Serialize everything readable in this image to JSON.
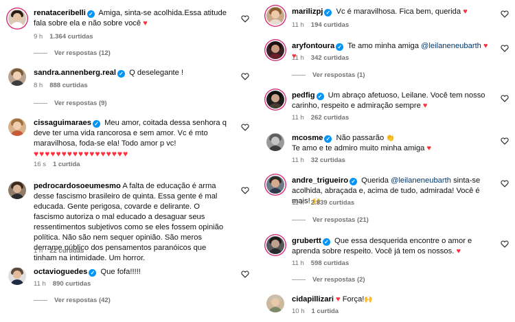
{
  "left": [
    {
      "username": "renataceribelli",
      "verified": true,
      "text": "Amiga, sinta-se acolhida.Essa atitude fala sobre ela e não sobre você",
      "trailing": "♥",
      "time": "9 h",
      "likes": "1.364 curtidas",
      "replies": "Ver respostas (12)"
    },
    {
      "username": "sandra.annenberg.real",
      "verified": true,
      "text": "Q deselegante !",
      "time": "8 h",
      "likes": "888 curtidas",
      "replies": "Ver respostas (9)"
    },
    {
      "username": "cissaguimaraes",
      "verified": true,
      "text": "Meu amor, coitada dessa senhora q deve ter uma vida rancorosa e sem amor. Vc é mto maravilhosa, foda-se ela! Todo amor p vc!",
      "hearts": "♥♥♥♥♥♥♥♥♥♥♥♥♥♥♥♥♥",
      "time": "16 s",
      "likes": "1 curtida"
    },
    {
      "username": "pedrocardosoeumesmo",
      "verified": false,
      "text": "A falta de educação é arma desse fascismo brasileiro de quinta. Essa gente é mal educada. Gente perigosa, covarde e delirante. O fascismo autoriza o mal educado a desaguar seus ressentimentos subjetivos como se eles fossem opinião política. Não são nem sequer opinião. São meros derrame público dos pensamentos paranóicos que tinham na intimidade. Um horror.",
      "time": "1 h",
      "likes": "22 curtidas"
    },
    {
      "username": "octavioguedes",
      "verified": true,
      "text": "Que fofa!!!!!",
      "time": "11 h",
      "likes": "890 curtidas",
      "replies": "Ver respostas (42)"
    }
  ],
  "right": [
    {
      "username": "marilizpj",
      "verified": true,
      "text": "Vc é maravilhosa. Fica bem, querida",
      "trailing": "♥",
      "time": "11 h",
      "likes": "194 curtidas"
    },
    {
      "username": "aryfontoura",
      "verified": true,
      "text": "Te amo minha amiga",
      "mention": "@leilaneneubarth",
      "trailing": "♥ ♥",
      "time": "11 h",
      "likes": "342 curtidas",
      "replies": "Ver respostas (1)"
    },
    {
      "username": "pedfig",
      "verified": true,
      "text": "Um abraço afetuoso, Leilane. Você tem nosso carinho, respeito e admiração sempre",
      "trailing": "♥",
      "time": "11 h",
      "likes": "262 curtidas"
    },
    {
      "username": "mcosme",
      "verified": true,
      "text": "Não passarão",
      "emoji": "👏",
      "text2": "Te amo e te admiro muito minha amiga",
      "trailing": "♥",
      "time": "11 h",
      "likes": "32 curtidas"
    },
    {
      "username": "andre_trigueiro",
      "verified": true,
      "text_before": "Querida",
      "mention": "@leilaneneubarth",
      "text": "sinta-se acolhida, abraçada e, acima de tudo, admirada! Você é mais!",
      "emoji": "🙌",
      "time": "11 h",
      "likes": "2.839 curtidas",
      "replies": "Ver respostas (21)"
    },
    {
      "username": "grubertt",
      "verified": true,
      "text": "Que essa desquerida encontre o amor e aprenda sobre respeito. Você já tem os nossos.",
      "trailing": "♥",
      "time": "11 h",
      "likes": "598 curtidas",
      "replies": "Ver respostas (2)"
    },
    {
      "username": "cidapillizari",
      "verified": false,
      "trailing": "♥",
      "text": "Força!",
      "emoji": "🙌",
      "time": "10 h",
      "likes": "1 curtida"
    }
  ],
  "icons": {
    "like": "heart-outline-icon"
  },
  "colors": {
    "verified": "#0095f6",
    "heart": "#ff3040",
    "mention": "#00376b",
    "meta": "#737373",
    "story_ring": "#d62976"
  }
}
